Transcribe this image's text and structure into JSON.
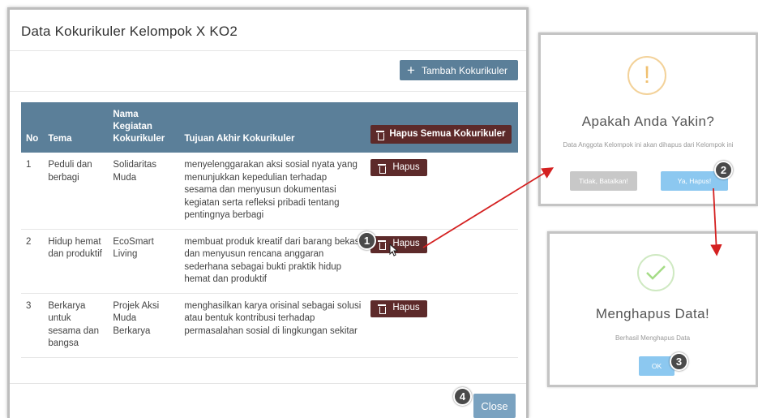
{
  "modal": {
    "title": "Data Kokurikuler Kelompok X KO2",
    "add_button": "Tambah Kokurikuler",
    "close_button": "Close"
  },
  "table": {
    "headers": {
      "no": "No",
      "tema": "Tema",
      "nama": "Nama Kegiatan Kokurikuler",
      "tujuan": "Tujuan Akhir Kokurikuler",
      "delete_all": "Hapus Semua Kokurikuler"
    },
    "delete_label": "Hapus",
    "rows": [
      {
        "no": "1",
        "tema": "Peduli dan berbagi",
        "nama": "Solidaritas Muda",
        "tujuan": "menyelenggarakan aksi sosial nyata yang menunjukkan kepedulian terhadap sesama dan menyusun dokumentasi kegiatan serta refleksi pribadi tentang pentingnya berbagi"
      },
      {
        "no": "2",
        "tema": "Hidup hemat dan produktif",
        "nama": "EcoSmart Living",
        "tujuan": "membuat produk kreatif dari barang bekas dan menyusun rencana anggaran sederhana sebagai bukti praktik hidup hemat dan produktif"
      },
      {
        "no": "3",
        "tema": "Berkarya untuk sesama dan bangsa",
        "nama": "Projek Aksi Muda Berkarya",
        "tujuan": "menghasilkan karya orisinal sebagai solusi atau bentuk kontribusi terhadap permasalahan sosial di lingkungan sekitar"
      }
    ]
  },
  "confirm_dialog": {
    "icon": "warning-icon",
    "title": "Apakah Anda Yakin?",
    "text": "Data Anggota Kelompok ini akan dihapus dari Kelompok ini",
    "cancel_button": "Tidak, Batalkan!",
    "confirm_button": "Ya, Hapus!"
  },
  "success_dialog": {
    "icon": "checkmark-icon",
    "title": "Menghapus Data!",
    "text": "Berhasil Menghapus Data",
    "ok_button": "OK"
  },
  "steps": [
    "1",
    "2",
    "3",
    "4"
  ],
  "colors": {
    "header": "#5b7f99",
    "danger": "#5d2a2a",
    "primary_light": "#8cc8f0",
    "close": "#7aa2c0",
    "arrow": "#d42020"
  }
}
